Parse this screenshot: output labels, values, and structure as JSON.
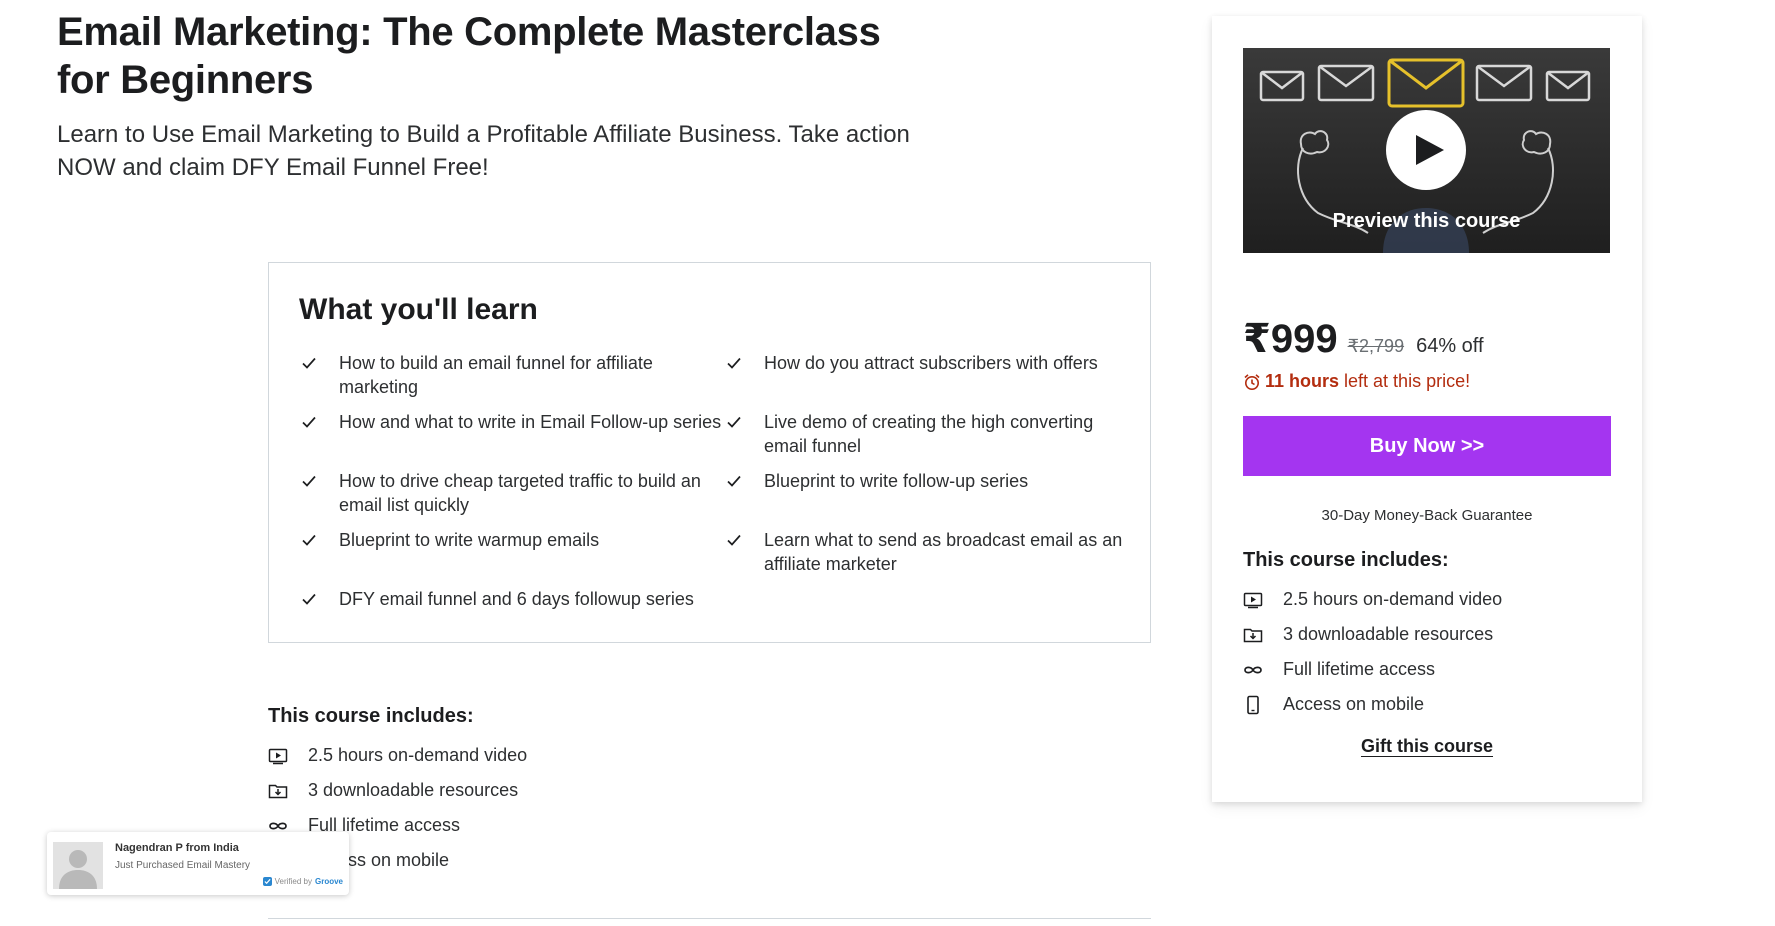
{
  "hero": {
    "title": "Email Marketing: The Complete Masterclass for Beginners",
    "subtitle": "Learn to Use Email Marketing to Build a Profitable Affiliate Business. Take action NOW and claim DFY Email Funnel Free!"
  },
  "learn": {
    "title": "What you'll learn",
    "items": [
      "How to build an email funnel for affiliate marketing",
      "How do you attract subscribers with offers",
      "How and what to write in Email Follow-up series",
      "Live demo of creating the high converting email funnel",
      "How to drive cheap targeted traffic to build an email list quickly",
      "Blueprint to write follow-up series",
      "Blueprint to write warmup emails",
      "Learn what to send as broadcast email as an affiliate marketer",
      "DFY email funnel and 6 days followup series"
    ]
  },
  "includes": {
    "title": "This course includes:",
    "items": [
      {
        "icon": "video-icon",
        "label": "2.5 hours on-demand video"
      },
      {
        "icon": "download-icon",
        "label": "3 downloadable resources"
      },
      {
        "icon": "infinity-icon",
        "label": "Full lifetime access"
      },
      {
        "icon": "mobile-icon",
        "label": "Access on mobile"
      }
    ]
  },
  "sidebar": {
    "preview_label": "Preview this course",
    "price_current": "₹999",
    "price_original": "₹2,799",
    "discount": "64% off",
    "timer_hours": "11 hours",
    "timer_rest": "left at this price!",
    "buy_label": "Buy Now >>",
    "guarantee": "30-Day Money-Back Guarantee",
    "gift_label": "Gift this course"
  },
  "toast": {
    "name": "Nagendran P from India",
    "action": "Just Purchased Email Mastery",
    "verified_label": "Verified by",
    "brand": "Groove"
  },
  "colors": {
    "accent": "#a435f0",
    "timer": "#b32d0f",
    "text": "#1c1d1f",
    "border": "#d1d7dc",
    "verified": "#2a87d0"
  }
}
